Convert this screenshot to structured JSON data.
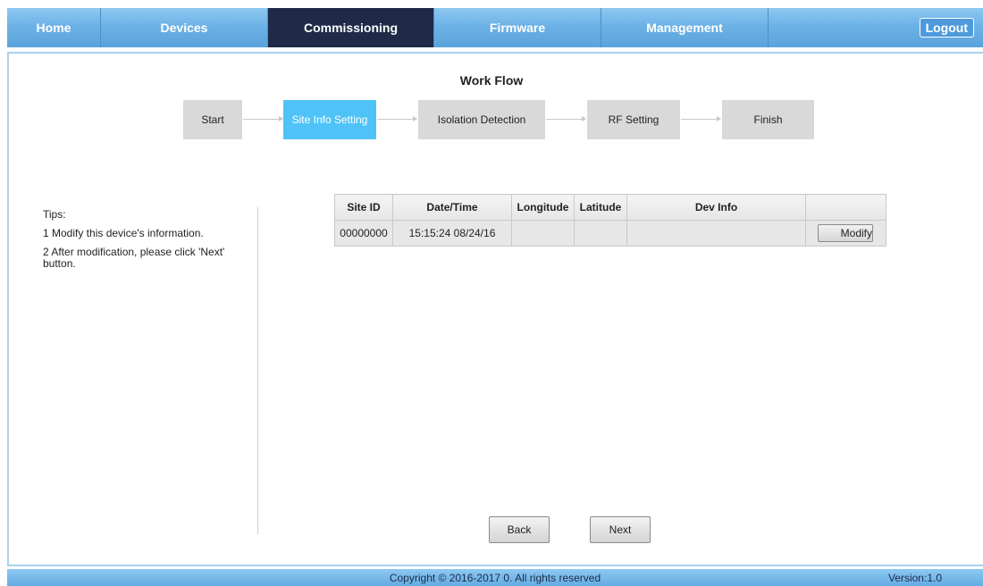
{
  "nav": {
    "tabs": [
      {
        "label": "Home"
      },
      {
        "label": "Devices"
      },
      {
        "label": "Commissioning"
      },
      {
        "label": "Firmware"
      },
      {
        "label": "Management"
      }
    ],
    "active_tab": "Commissioning",
    "logout_label": "Logout"
  },
  "workflow": {
    "title": "Work Flow",
    "steps": [
      {
        "label": "Start"
      },
      {
        "label": "Site Info Setting"
      },
      {
        "label": "Isolation Detection"
      },
      {
        "label": "RF Setting"
      },
      {
        "label": "Finish"
      }
    ],
    "active_step": "Site Info Setting"
  },
  "tips": {
    "heading": "Tips:",
    "lines": [
      "1 Modify this device's information.",
      "2 After modification, please click 'Next' button."
    ]
  },
  "table": {
    "headers": [
      "Site ID",
      "Date/Time",
      "Longitude",
      "Latitude",
      "Dev Info",
      ""
    ],
    "rows": [
      {
        "site_id": "00000000",
        "datetime": "15:15:24 08/24/16",
        "longitude": "",
        "latitude": "",
        "dev_info": "",
        "action": "Modify"
      }
    ]
  },
  "buttons": {
    "back": "Back",
    "next": "Next"
  },
  "footer": {
    "copyright": "Copyright © 2016-2017 0. All rights reserved",
    "version": "Version:1.0"
  },
  "colors": {
    "nav_bg": "#6db2e6",
    "nav_active": "#1e2a48",
    "step_active": "#4fc3f7",
    "step_inactive": "#d9d9d9"
  }
}
